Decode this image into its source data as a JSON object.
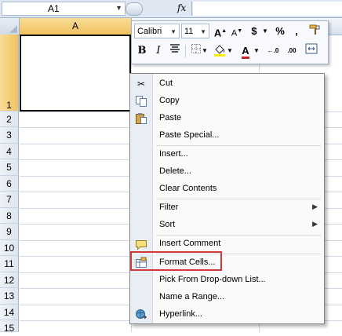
{
  "name_box": {
    "value": "A1"
  },
  "formula_bar": {
    "fx_label": "fx"
  },
  "columns": [
    {
      "label": "A",
      "selected": true
    }
  ],
  "rows": [
    "1",
    "2",
    "3",
    "4",
    "5",
    "6",
    "7",
    "8",
    "9",
    "10",
    "11",
    "12",
    "13",
    "14",
    "15"
  ],
  "mini_toolbar": {
    "font": "Calibri",
    "size": "11",
    "grow_label": "A",
    "shrink_label": "A",
    "currency": "$",
    "percent": "%",
    "comma": ",",
    "bold": "B",
    "italic": "I",
    "font_color_label": "A",
    "inc_decimal": "←.0",
    "dec_decimal": ".00",
    "font_color_hex": "#c0262b",
    "fill_color_hex": "#ffef00"
  },
  "context_menu": {
    "items": [
      {
        "label": "Cut",
        "icon": "scissors-icon"
      },
      {
        "label": "Copy",
        "icon": "copy-icon"
      },
      {
        "label": "Paste",
        "icon": "paste-icon"
      },
      {
        "label": "Paste Special..."
      },
      {
        "label": "Insert..."
      },
      {
        "label": "Delete..."
      },
      {
        "label": "Clear Contents"
      },
      {
        "label": "Filter",
        "submenu": true
      },
      {
        "label": "Sort",
        "submenu": true
      },
      {
        "label": "Insert Comment",
        "icon": "comment-icon"
      },
      {
        "label": "Format Cells...",
        "icon": "format-cells-icon",
        "highlighted": true
      },
      {
        "label": "Pick From Drop-down List..."
      },
      {
        "label": "Name a Range..."
      },
      {
        "label": "Hyperlink...",
        "icon": "hyperlink-icon"
      }
    ]
  },
  "colors": {
    "highlight_border": "#d33a37",
    "selected_header": "#f1c15f"
  }
}
